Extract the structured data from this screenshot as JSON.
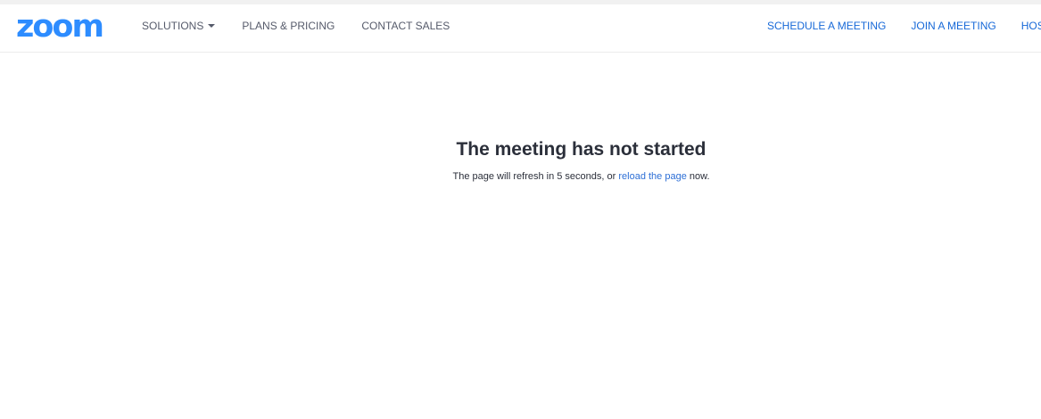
{
  "header": {
    "logo": "zoom",
    "nav_left": [
      {
        "label": "SOLUTIONS"
      },
      {
        "label": "PLANS & PRICING"
      },
      {
        "label": "CONTACT SALES"
      }
    ],
    "nav_right": [
      {
        "label": "SCHEDULE A MEETING"
      },
      {
        "label": "JOIN A MEETING"
      },
      {
        "label": "HOST"
      }
    ]
  },
  "main": {
    "title": "The meeting has not started",
    "message_prefix": "The page will refresh in 5 seconds, or ",
    "reload_link": "reload the page",
    "message_suffix": " now."
  },
  "colors": {
    "brand": "#2d8cff",
    "link": "#1769d8"
  }
}
